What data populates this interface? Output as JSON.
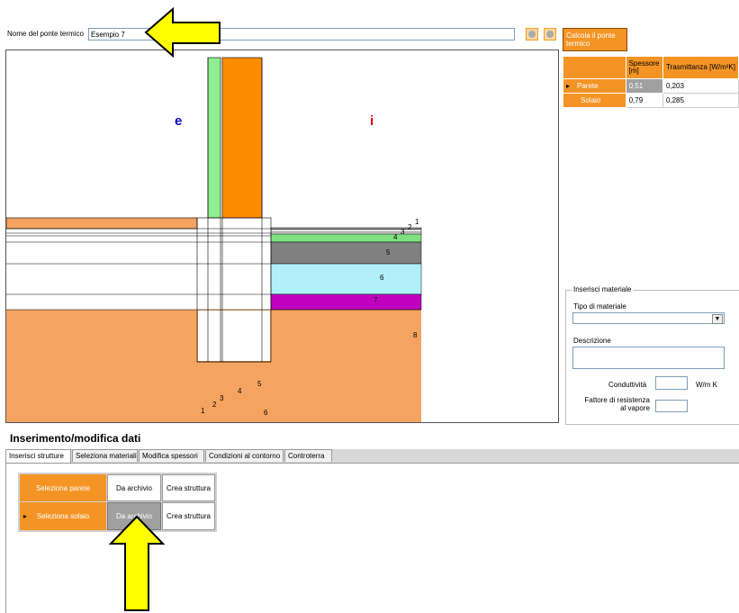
{
  "header": {
    "name_label": "Nome del ponte termico",
    "name_value": "Esempio 7",
    "calc_button": "Calcola il ponte termico"
  },
  "drawing": {
    "label_exterior": "e",
    "label_interior": "i",
    "layer_numbers_floor": [
      "1",
      "2",
      "3",
      "4",
      "5",
      "6",
      "7",
      "8"
    ],
    "layer_numbers_wall": [
      "1",
      "2",
      "3",
      "4",
      "5",
      "6"
    ],
    "colors": {
      "exterior_soil": "#f4a460",
      "wall_insulation": "#90ee90",
      "wall_core": "#ff8c00",
      "floor_gray": "#808080",
      "floor_cyan": "#b0f0f8",
      "floor_magenta": "#c000c0",
      "floor_green": "#80e080"
    }
  },
  "structures_table": {
    "col_headers": [
      "Spessore [m]",
      "Trasmittanza [W/m²K]"
    ],
    "rows": [
      {
        "name": "Parete",
        "thickness": "0,51",
        "transmittance": "0,203",
        "selected": true
      },
      {
        "name": "Solaio",
        "thickness": "0,79",
        "transmittance": "0,285",
        "selected": false
      }
    ]
  },
  "material_panel": {
    "group_title": "Inserisci materiale",
    "type_label": "Tipo di materiale",
    "description_label": "Descrizione",
    "conductivity_label": "Conduttività",
    "conductivity_unit": "W/m K",
    "vapor_label_1": "Fattore di resistenza",
    "vapor_label_2": "al vapore"
  },
  "section": {
    "title": "Inserimento/modifica dati",
    "tabs": [
      "Inserisci strutture",
      "Seleziona materiali",
      "Modifica spessori",
      "Condizioni al contorno",
      "Controterra"
    ],
    "active_tab": 0
  },
  "selection_grid": {
    "rows": [
      {
        "label": "Seleziona parete",
        "archive": "Da archivio",
        "create": "Crea struttura"
      },
      {
        "label": "Seleziona solaio",
        "archive": "Da archivio",
        "create": "Crea struttura"
      }
    ]
  },
  "annotations": {
    "arrow_color": "#ffff00"
  }
}
